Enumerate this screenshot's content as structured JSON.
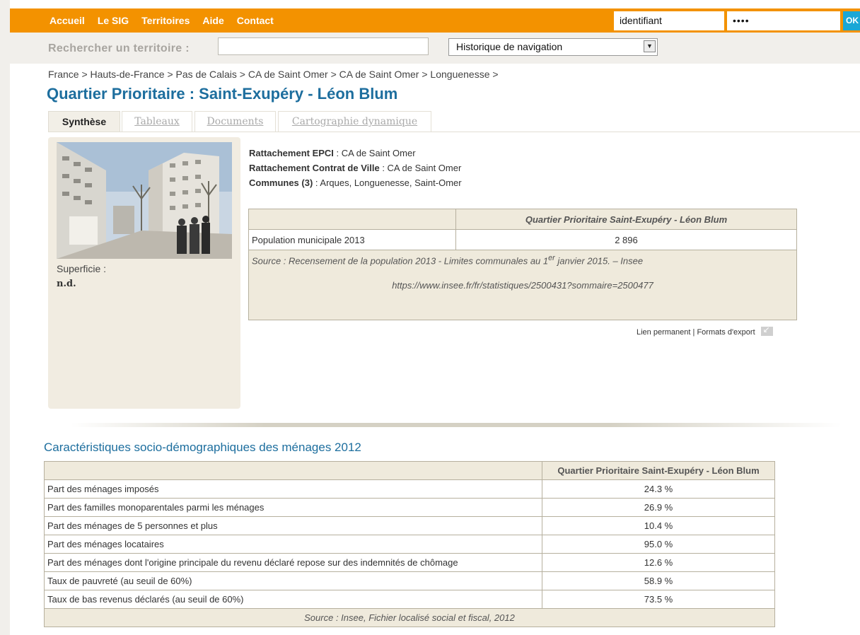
{
  "nav": {
    "items": [
      "Accueil",
      "Le SIG",
      "Territoires",
      "Aide",
      "Contact"
    ]
  },
  "login": {
    "identifiant": "identifiant",
    "password_mask": "••••",
    "ok_label": "OK"
  },
  "search": {
    "label": "Rechercher un territoire :",
    "value": "",
    "history_selected": "Historique de navigation"
  },
  "breadcrumb": "France > Hauts-de-France > Pas de Calais > CA de Saint Omer > CA de Saint Omer > Longuenesse >",
  "title": "Quartier Prioritaire : Saint-Exupéry - Léon Blum",
  "tabs": [
    {
      "label": "Synthèse",
      "active": true
    },
    {
      "label": "Tableaux",
      "active": false
    },
    {
      "label": "Documents",
      "active": false
    },
    {
      "label": "Cartographie dynamique",
      "active": false
    }
  ],
  "left": {
    "superficie_label": "Superficie :",
    "superficie_value": "n.d."
  },
  "info": {
    "epci_label": "Rattachement EPCI",
    "epci_value": " : CA de Saint Omer",
    "contrat_label": "Rattachement Contrat de Ville",
    "contrat_value": " : CA de Saint Omer",
    "communes_label": "Communes (3)",
    "communes_value": " : Arques, Longuenesse, Saint-Omer"
  },
  "pop_table": {
    "header": "Quartier Prioritaire Saint-Exupéry - Léon Blum",
    "row_label": "Population municipale 2013",
    "row_value": "2 896",
    "source_a": "Source : Recensement de la population 2013 - Limites communales au 1",
    "source_sup": "er",
    "source_b": " janvier 2015. – Insee",
    "source_url": "https://www.insee.fr/fr/statistiques/2500431?sommaire=2500477"
  },
  "links": {
    "permanent": "Lien permanent",
    "sep": " | ",
    "export": "Formats d'export"
  },
  "menages": {
    "title": "Caractéristiques socio-démographiques des ménages 2012",
    "header": "Quartier Prioritaire Saint-Exupéry - Léon Blum",
    "rows": [
      {
        "label": "Part des ménages imposés",
        "value": "24.3 %"
      },
      {
        "label": "Part des familles monoparentales parmi les ménages",
        "value": "26.9 %"
      },
      {
        "label": "Part des ménages de 5 personnes et plus",
        "value": "10.4 %"
      },
      {
        "label": "Part des ménages locataires",
        "value": "95.0 %"
      },
      {
        "label": "Part des ménages dont l'origine principale du revenu déclaré repose sur des indemnités de chômage",
        "value": "12.6 %"
      },
      {
        "label": "Taux de pauvreté (au seuil de 60%)",
        "value": "58.9 %"
      },
      {
        "label": "Taux de bas revenus déclarés (au seuil de 60%)",
        "value": "73.5 %"
      }
    ],
    "source": "Source : Insee, Fichier localisé social et fiscal, 2012"
  },
  "colors": {
    "topbar": "#f39200",
    "title": "#1d6e9e",
    "ok": "#1aa7d6",
    "panel": "#f1ece1"
  }
}
